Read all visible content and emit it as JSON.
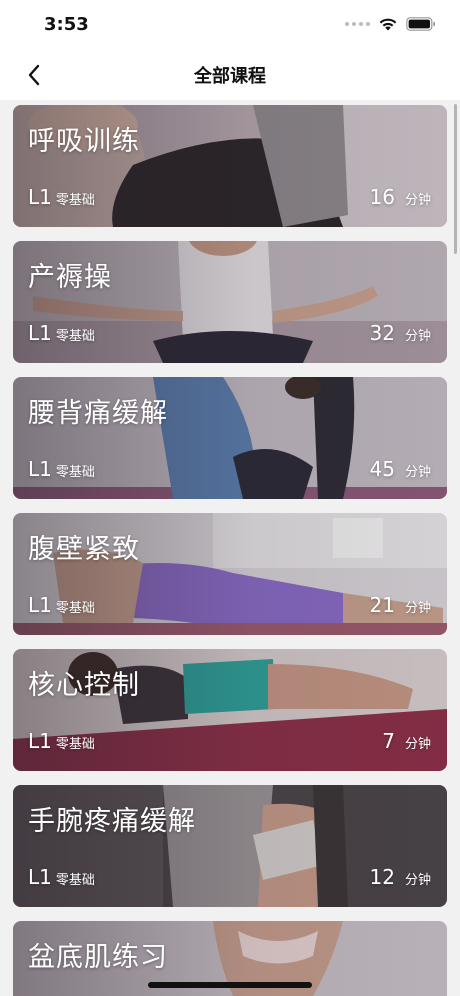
{
  "status_bar": {
    "time": "3:53"
  },
  "nav": {
    "title": "全部课程",
    "back_icon": "chevron-left-icon"
  },
  "courses": [
    {
      "title": "呼吸训练",
      "level": "L1",
      "level_desc": "零基础",
      "duration": "16",
      "unit": "分钟"
    },
    {
      "title": "产褥操",
      "level": "L1",
      "level_desc": "零基础",
      "duration": "32",
      "unit": "分钟"
    },
    {
      "title": "腰背痛缓解",
      "level": "L1",
      "level_desc": "零基础",
      "duration": "45",
      "unit": "分钟"
    },
    {
      "title": "腹壁紧致",
      "level": "L1",
      "level_desc": "零基础",
      "duration": "21",
      "unit": "分钟"
    },
    {
      "title": "核心控制",
      "level": "L1",
      "level_desc": "零基础",
      "duration": "7",
      "unit": "分钟"
    },
    {
      "title": "手腕疼痛缓解",
      "level": "L1",
      "level_desc": "零基础",
      "duration": "12",
      "unit": "分钟"
    },
    {
      "title": "盆底肌练习"
    }
  ]
}
